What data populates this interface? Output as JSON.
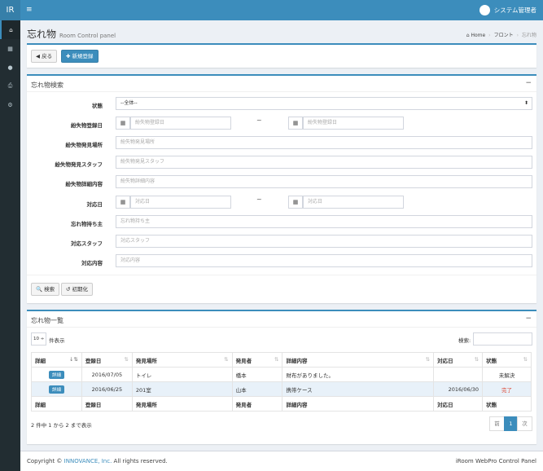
{
  "app": {
    "logo": "IR",
    "menu_icon": "≡",
    "user_name": "システム管理者"
  },
  "sidebar": {
    "icons": [
      "home-icon",
      "calendar-icon",
      "user-icon",
      "print-icon",
      "settings-icon"
    ],
    "glyphs": [
      "⌂",
      "▦",
      "●",
      "⎙",
      "⚙"
    ]
  },
  "page": {
    "title": "忘れ物",
    "subtitle": "Room Control panel",
    "breadcrumb": {
      "home": "Home",
      "front": "フロント",
      "current": "忘れ物"
    }
  },
  "actions": {
    "back": "◀ 戻る",
    "new": "✚ 新規登録"
  },
  "search": {
    "title": "忘れ物検索",
    "collapse": "−",
    "tilde": "~",
    "labels": {
      "status": "状態",
      "reg_date": "紛失物登録日",
      "place": "紛失物発見場所",
      "staff": "紛失物発見スタッフ",
      "detail": "紛失物詳細内容",
      "handled_date": "対応日",
      "owner": "忘れ物持ち主",
      "handle_staff": "対応スタッフ",
      "handle_content": "対応内容"
    },
    "status_value": "--全体--",
    "placeholders": {
      "reg_date": "紛失物登録日",
      "place": "紛失物発見場所",
      "staff": "紛失物発見スタッフ",
      "detail": "紛失物詳細内容",
      "handled_date": "対応日",
      "owner": "忘れ物持ち主",
      "handle_staff": "対応スタッフ",
      "handle_content": "対応内容"
    },
    "buttons": {
      "search": "🔍 検索",
      "reset": "↺ 初期化"
    }
  },
  "list": {
    "title": "忘れ物一覧",
    "collapse": "−",
    "page_size": "10 ÷",
    "page_size_suffix": "件表示",
    "search_label": "検索:",
    "columns": [
      "詳細",
      "登録日",
      "発見場所",
      "発見者",
      "詳細内容",
      "対応日",
      "状態"
    ],
    "rows": [
      {
        "detail": "詳細",
        "date": "2016/07/05",
        "place": "トイレ",
        "finder": "橋本",
        "content": "財布がありました。",
        "handled": "",
        "status": "未解決"
      },
      {
        "detail": "詳細",
        "date": "2016/06/25",
        "place": "201室",
        "finder": "山本",
        "content": "携帯ケース",
        "handled": "2016/06/30",
        "status": "完了"
      }
    ],
    "info": "2 件中 1 から 2 まで表示",
    "pagination": {
      "prev": "前",
      "page": "1",
      "next": "次"
    }
  },
  "footer": {
    "copyright": "Copyright ©",
    "company": "INNOVANCE, Inc.",
    "rights": "All rights reserved.",
    "product": "iRoom WebPro",
    "product_suffix": "Control Panel"
  }
}
